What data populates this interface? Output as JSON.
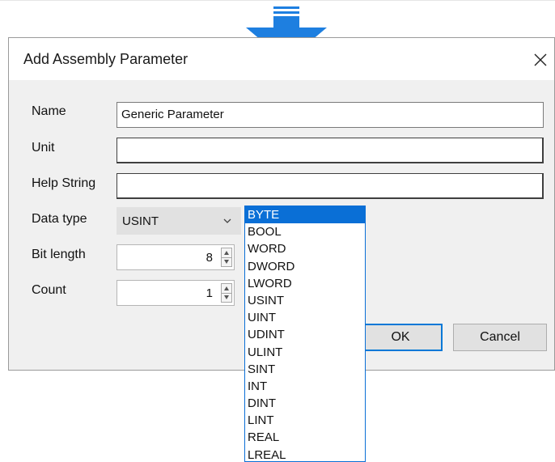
{
  "dialog": {
    "title": "Add Assembly Parameter",
    "fields": {
      "name": {
        "label": "Name",
        "value": "Generic Parameter"
      },
      "unit": {
        "label": "Unit",
        "value": ""
      },
      "help": {
        "label": "Help String",
        "value": ""
      },
      "datatype": {
        "label": "Data type",
        "value": "USINT"
      },
      "bitlength": {
        "label": "Bit length",
        "value": "8"
      },
      "count": {
        "label": "Count",
        "value": "1"
      }
    },
    "buttons": {
      "ok": "OK",
      "cancel": "Cancel"
    }
  },
  "dropdown": {
    "selected": "BYTE",
    "options": [
      "BYTE",
      "BOOL",
      "WORD",
      "DWORD",
      "LWORD",
      "USINT",
      "UINT",
      "UDINT",
      "ULINT",
      "SINT",
      "INT",
      "DINT",
      "LINT",
      "REAL",
      "LREAL"
    ]
  },
  "icons": {
    "arrow": "down-arrow-icon",
    "close": "close-icon",
    "chevron": "chevron-down-icon",
    "spin_up": "spin-up-icon",
    "spin_down": "spin-down-icon"
  },
  "colors": {
    "accent": "#0a6fd6",
    "arrow": "#1e7fe0",
    "dialog_bg": "#f0f0f0",
    "button_bg": "#e1e1e1"
  }
}
